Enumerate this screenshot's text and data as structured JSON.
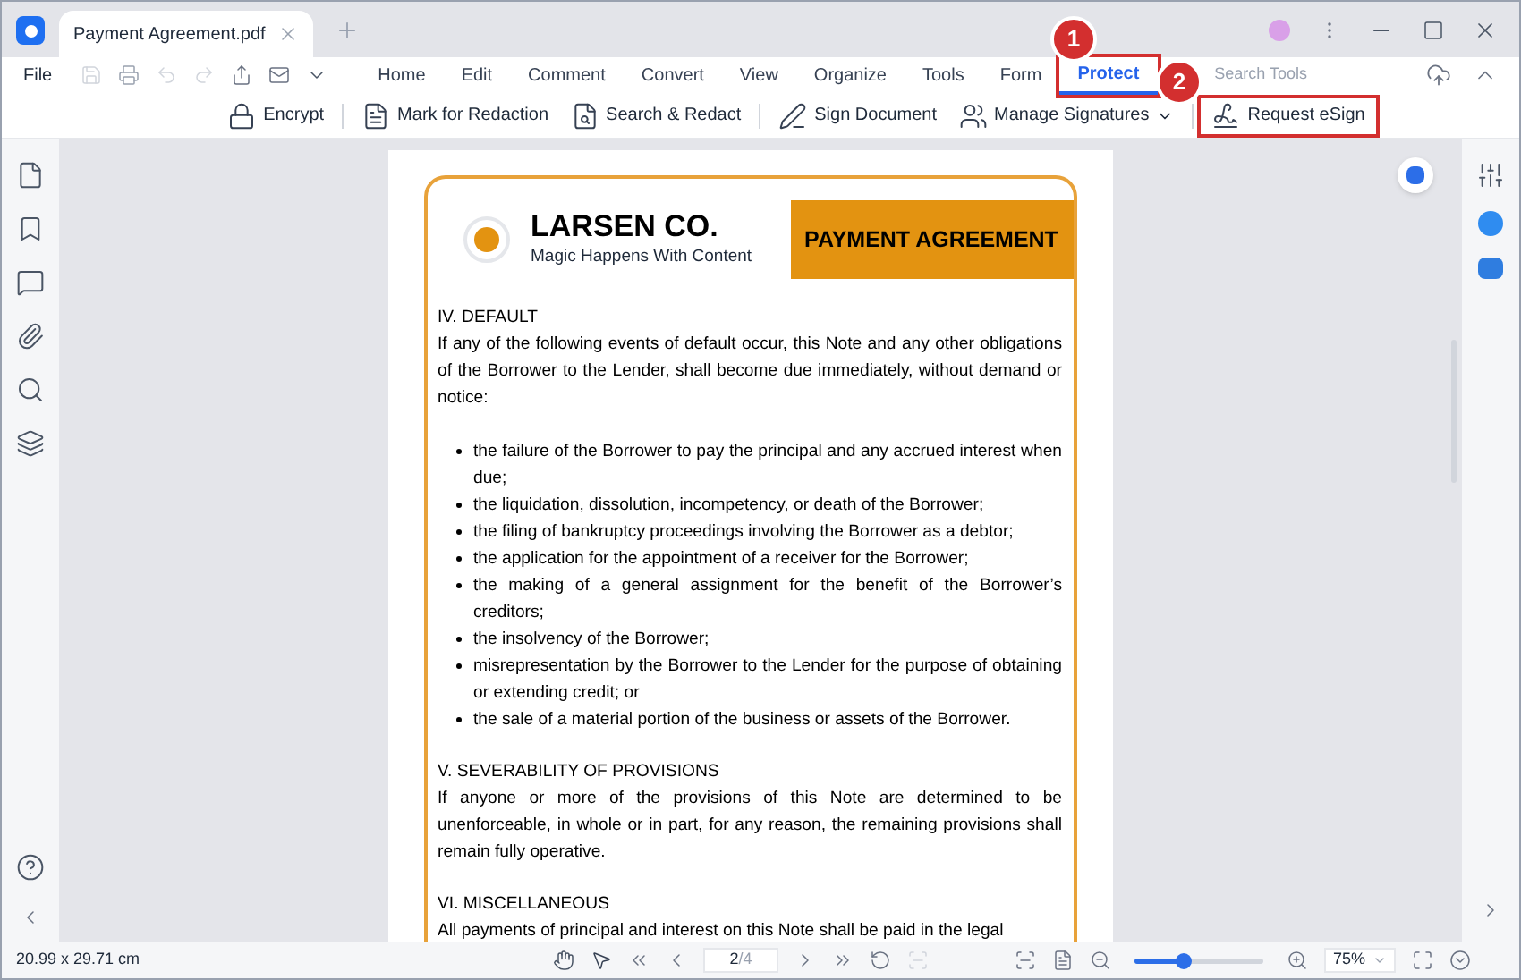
{
  "window": {
    "tab_title": "Payment Agreement.pdf"
  },
  "menu": {
    "file": "File",
    "tabs": [
      {
        "label": "Home",
        "selected": false
      },
      {
        "label": "Edit",
        "selected": false
      },
      {
        "label": "Comment",
        "selected": false
      },
      {
        "label": "Convert",
        "selected": false
      },
      {
        "label": "View",
        "selected": false
      },
      {
        "label": "Organize",
        "selected": false
      },
      {
        "label": "Tools",
        "selected": false
      },
      {
        "label": "Form",
        "selected": false
      },
      {
        "label": "Protect",
        "selected": true
      }
    ],
    "search": {
      "placeholder": "Search Tools"
    }
  },
  "toolbar": [
    {
      "kind": "lock",
      "label": "Encrypt",
      "dropdown": false
    },
    {
      "kind": "redact",
      "label": "Mark for Redaction",
      "dropdown": false
    },
    {
      "kind": "search-redact",
      "label": "Search & Redact",
      "dropdown": false
    },
    {
      "kind": "sign",
      "label": "Sign Document",
      "dropdown": false
    },
    {
      "kind": "signatures",
      "label": "Manage Signatures",
      "dropdown": true
    },
    {
      "kind": "esign",
      "label": "Request eSign",
      "dropdown": false
    }
  ],
  "callouts": [
    {
      "number": "1"
    },
    {
      "number": "2"
    }
  ],
  "document": {
    "company": "LARSEN CO.",
    "tagline": "Magic Happens With Content",
    "banner": "PAYMENT AGREEMENT",
    "sections": [
      {
        "heading": "IV. DEFAULT",
        "body": "If any of the following events of default occur, this Note and any other obligations of the Borrower to the Lender, shall become due immediately, without demand or notice:",
        "bullets": [
          "the failure of the Borrower to pay the principal and any accrued interest when due;",
          "the liquidation, dissolution, incompetency, or death of the Borrower;",
          "the filing of bankruptcy proceedings involving the Borrower as a debtor;",
          "the application for the appointment of a receiver for the Borrower;",
          "the making of a general assignment for the benefit of the Borrower’s creditors;",
          "the insolvency of the Borrower;",
          "misrepresentation by the Borrower to the Lender for the purpose of obtaining or extending credit; or",
          "the sale of a material portion of the business or assets of the Borrower."
        ]
      },
      {
        "heading": "V. SEVERABILITY OF PROVISIONS",
        "body": "If anyone or more of the provisions of this Note are determined to be unenforceable, in whole or in part, for any reason, the remaining provisions shall remain fully operative."
      },
      {
        "heading": "VI. MISCELLANEOUS",
        "body": "All payments of principal and interest on this Note shall be paid in the legal"
      }
    ]
  },
  "status_bar": {
    "page_size": "20.99 x 29.71 cm",
    "page": "2",
    "page_total": "/4",
    "zoom": {
      "level": 0.38
    },
    "zoom_value": "75%"
  }
}
